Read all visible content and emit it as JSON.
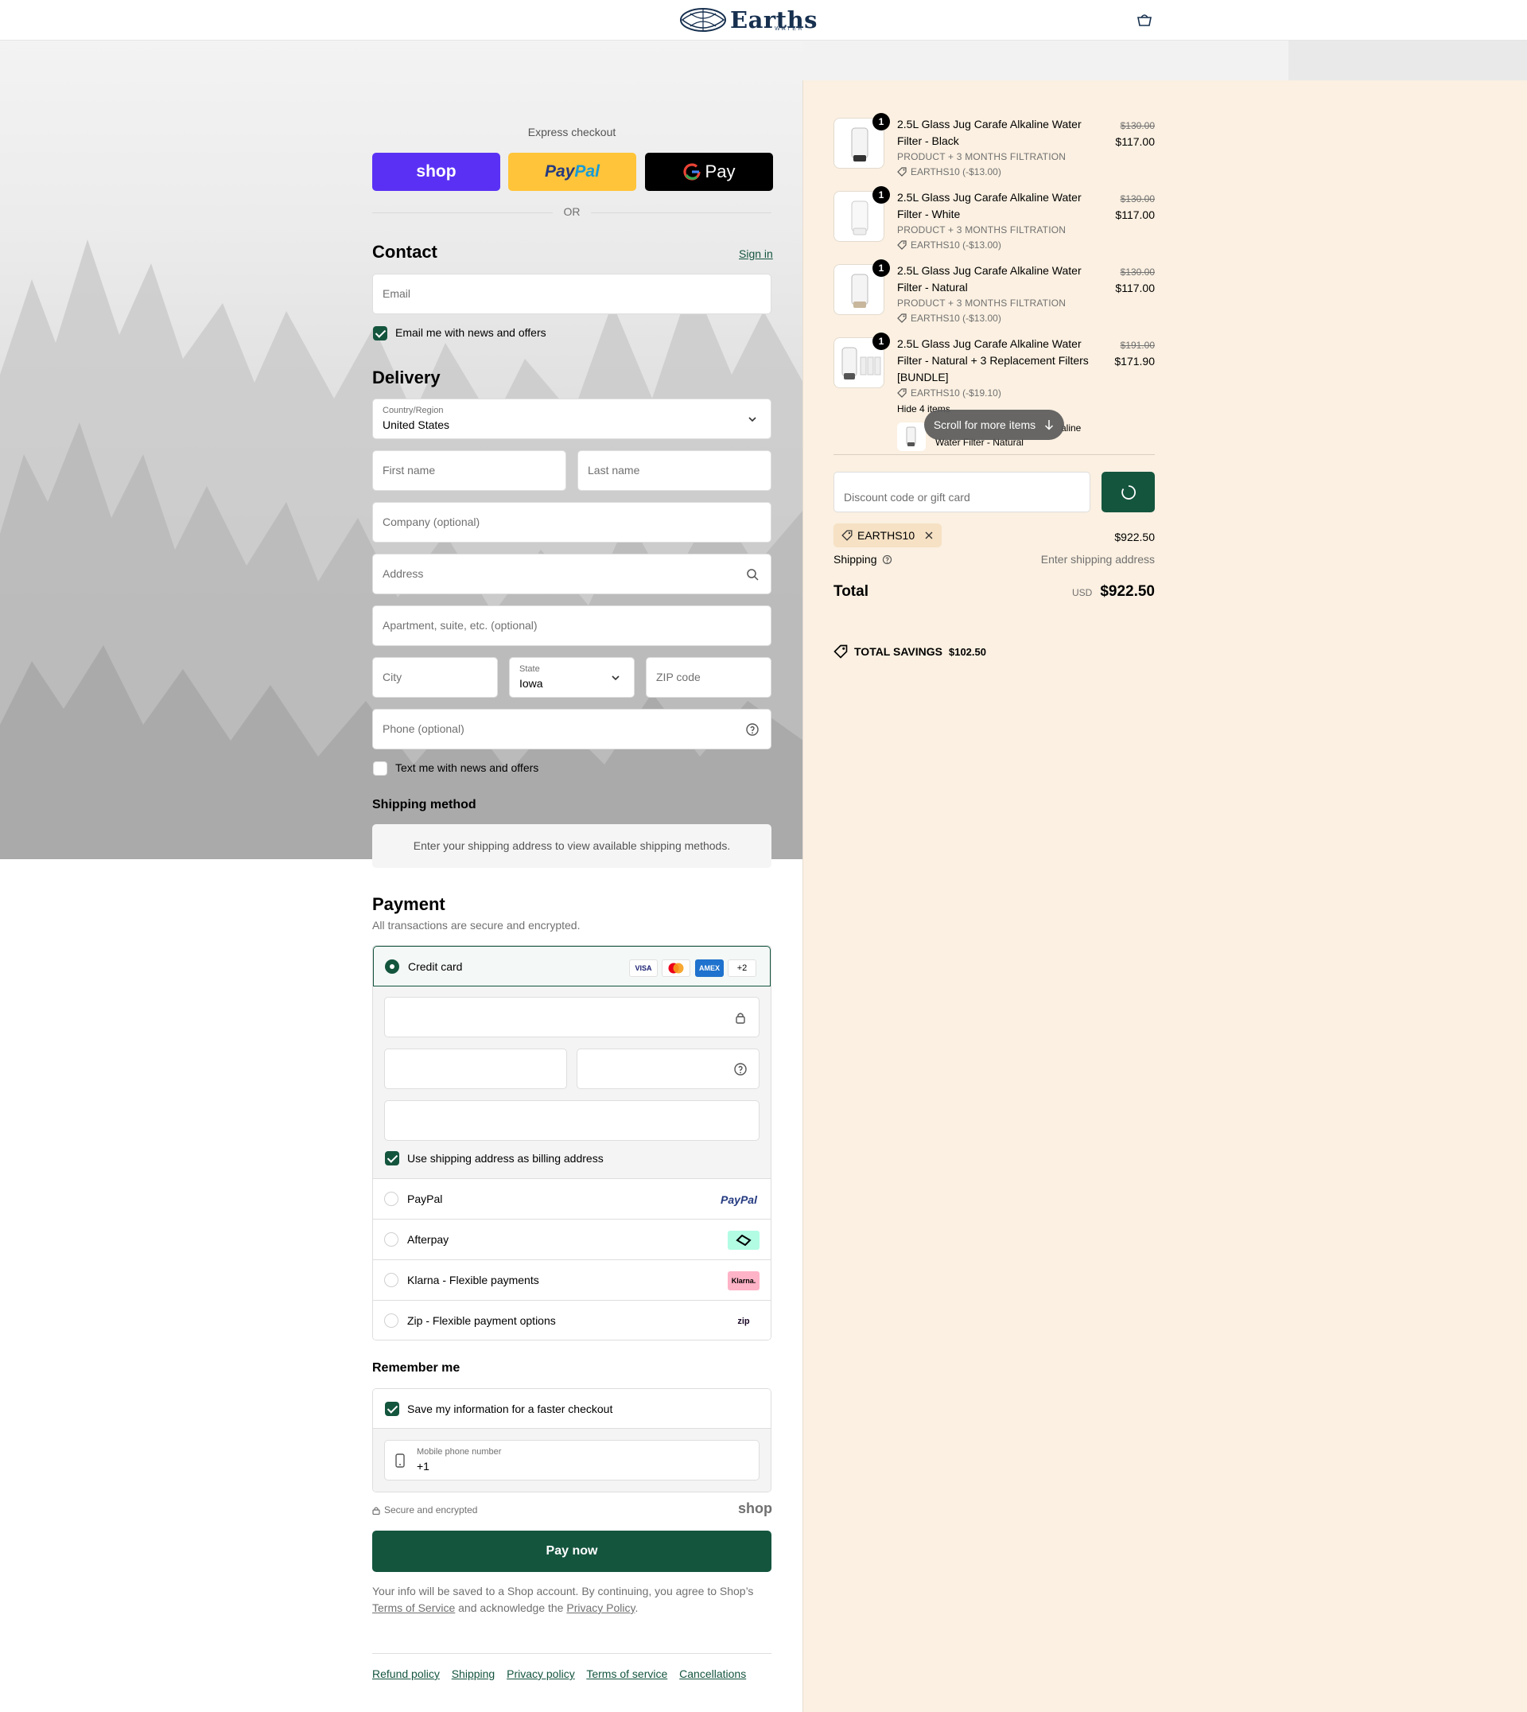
{
  "header": {
    "brand": "Earths",
    "brand_sub": "WATER"
  },
  "express": {
    "title": "Express checkout",
    "shop_label": "shop",
    "paypal_a": "Pay",
    "paypal_b": "Pal",
    "gpay_label": "Pay",
    "or_label": "OR"
  },
  "contact": {
    "title": "Contact",
    "sign_in": "Sign in",
    "email_placeholder": "Email",
    "news_label": "Email me with news and offers"
  },
  "delivery": {
    "title": "Delivery",
    "country_label": "Country/Region",
    "country_value": "United States",
    "first_name": "First name",
    "last_name": "Last name",
    "company": "Company (optional)",
    "address": "Address",
    "apartment": "Apartment, suite, etc. (optional)",
    "city": "City",
    "state_label": "State",
    "state_value": "Iowa",
    "zip": "ZIP code",
    "phone": "Phone (optional)",
    "text_label": "Text me with news and offers"
  },
  "shipping_method": {
    "title": "Shipping method",
    "message": "Enter your shipping address to view available shipping methods."
  },
  "payment": {
    "title": "Payment",
    "subtitle": "All transactions are secure and encrypted.",
    "credit_card": "Credit card",
    "card_badges": [
      "VISA",
      "",
      "AMEX",
      "+2"
    ],
    "billing_label": "Use shipping address as billing address",
    "options": [
      {
        "label": "PayPal",
        "logo": "PayPal"
      },
      {
        "label": "Afterpay",
        "logo": "afterpay"
      },
      {
        "label": "Klarna - Flexible payments",
        "logo": "Klarna."
      },
      {
        "label": "Zip - Flexible payment options",
        "logo": "zip"
      }
    ]
  },
  "remember": {
    "title": "Remember me",
    "save_label": "Save my information for a faster checkout",
    "mobile_label": "Mobile phone number",
    "mobile_value": "+1",
    "secure_label": "Secure and encrypted",
    "shop_label": "shop"
  },
  "pay_now": "Pay now",
  "legal": {
    "text_a": "Your info will be saved to a Shop account. By continuing, you agree to Shop’s",
    "terms": "Terms of Service",
    "text_b": "and acknowledge the",
    "privacy": "Privacy Policy",
    "text_c": "."
  },
  "footer_links": [
    "Refund policy",
    "Shipping",
    "Privacy policy",
    "Terms of service",
    "Cancellations"
  ],
  "summary": {
    "items": [
      {
        "qty": "1",
        "name": "2.5L Glass Jug Carafe Alkaline Water Filter - Black",
        "variant": "PRODUCT + 3 MONTHS FILTRATION",
        "discount": "EARTHS10 (-$13.00)",
        "old_price": "$130.00",
        "price": "$117.00"
      },
      {
        "qty": "1",
        "name": "2.5L Glass Jug Carafe Alkaline Water Filter - White",
        "variant": "PRODUCT + 3 MONTHS FILTRATION",
        "discount": "EARTHS10 (-$13.00)",
        "old_price": "$130.00",
        "price": "$117.00"
      },
      {
        "qty": "1",
        "name": "2.5L Glass Jug Carafe Alkaline Water Filter - Natural",
        "variant": "PRODUCT + 3 MONTHS FILTRATION",
        "discount": "EARTHS10 (-$13.00)",
        "old_price": "$130.00",
        "price": "$117.00"
      },
      {
        "qty": "1",
        "name": "2.5L Glass Jug Carafe Alkaline Water Filter - Natural + 3 Replacement Filters [BUNDLE]",
        "variant": "",
        "discount": "EARTHS10 (-$19.10)",
        "old_price": "$191.00",
        "price": "$171.90"
      }
    ],
    "hide_items": "Hide 4 items",
    "peek_name": "Water Filter - Natural",
    "peek_tail": "aline",
    "scroll_pill": "Scroll for more items",
    "discount_placeholder": "Discount code or gift card",
    "code": "EARTHS10",
    "subtotal": "$922.50",
    "shipping_label": "Shipping",
    "shipping_value": "Enter shipping address",
    "total_label": "Total",
    "currency": "USD",
    "total": "$922.50",
    "savings_label": "TOTAL SAVINGS",
    "savings_value": "$102.50"
  },
  "colors": {
    "accent": "#14553e",
    "summary_bg": "#fbf0e1",
    "shop_purple": "#5a31f4",
    "paypal_yellow": "#ffc439"
  }
}
